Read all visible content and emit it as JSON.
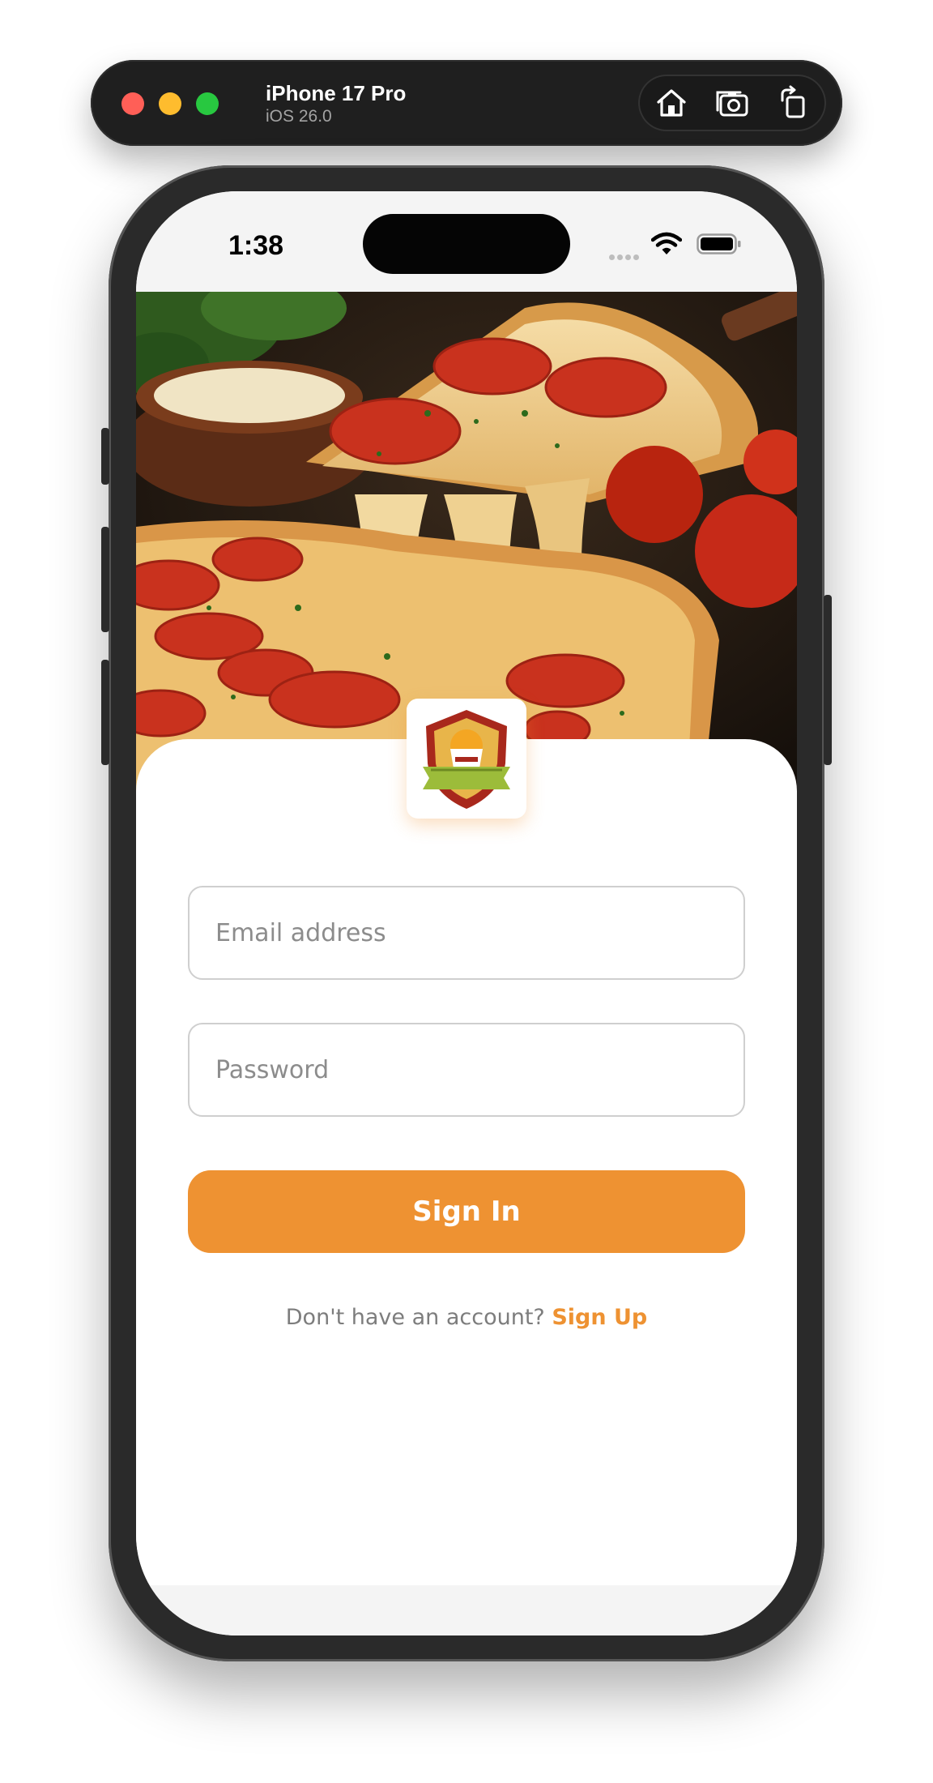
{
  "simulator": {
    "device_name": "iPhone 17 Pro",
    "os_version": "iOS 26.0",
    "traffic_lights": [
      "close",
      "minimize",
      "zoom"
    ],
    "tools": [
      "home-icon",
      "screenshot-icon",
      "rotate-icon"
    ]
  },
  "status_bar": {
    "time": "1:38",
    "icons": [
      "cellular-signal-icon",
      "wifi-icon",
      "battery-icon"
    ]
  },
  "hero": {
    "image": "pizza-photo"
  },
  "logo": {
    "icon": "restaurant-shield-logo-icon"
  },
  "form": {
    "email": {
      "placeholder": "Email address",
      "value": ""
    },
    "password": {
      "placeholder": "Password",
      "value": ""
    },
    "submit_label": "Sign In"
  },
  "footer": {
    "prompt": "Don't have an account?",
    "link_label": "Sign Up"
  },
  "colors": {
    "accent": "#EE9232",
    "placeholder": "#8C8C8C",
    "field_border": "#CFCFCF",
    "toolbar_bg": "#1F1F1F"
  }
}
